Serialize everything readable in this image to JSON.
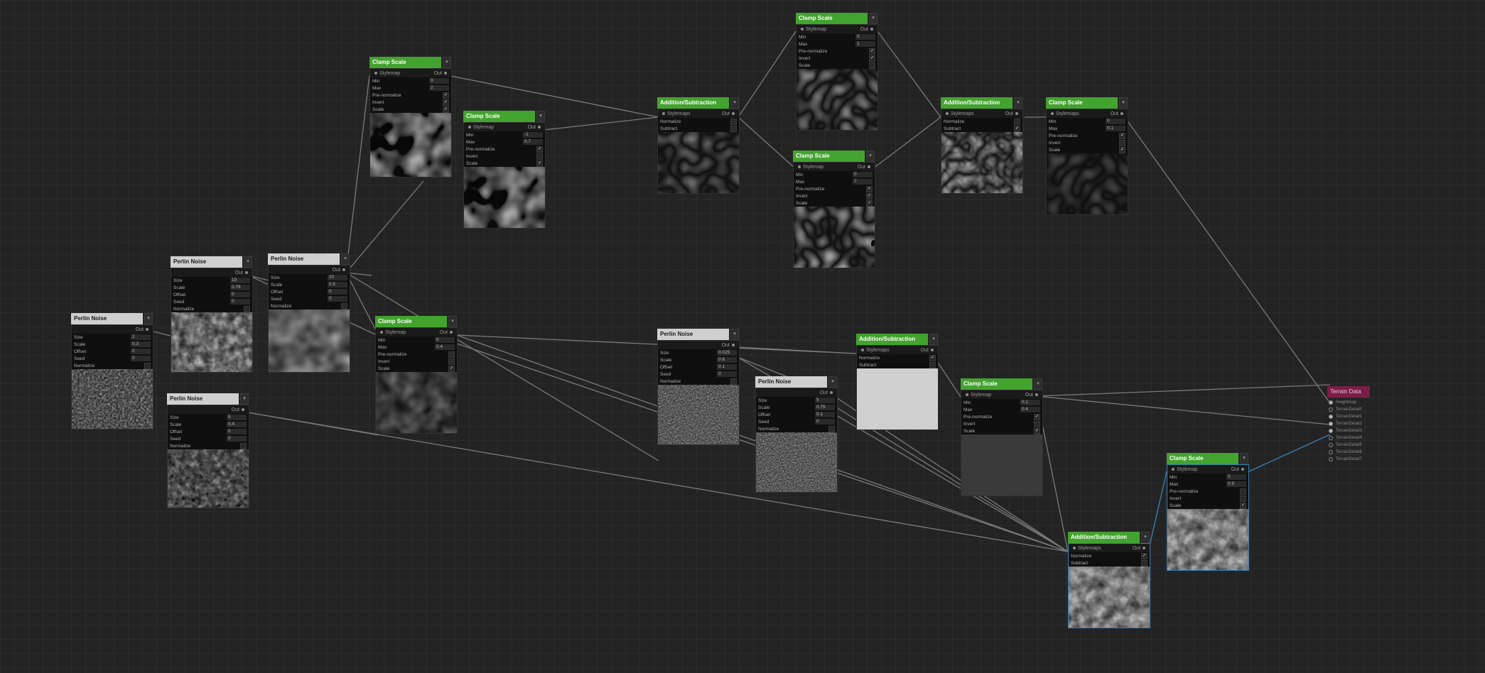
{
  "labels": {
    "out": "Out",
    "stylemap": "Stylemap",
    "stylemaps": "Stylemaps"
  },
  "colors": {
    "clamp_header": "#43a32f",
    "perlin_header": "#cfcfcf",
    "terrain_header": "#7a1e48",
    "wire": "#8a8a8a",
    "wire_selected": "#3a7cb4",
    "canvas": "#232323"
  },
  "icons": {
    "menu": "dropdown-arrow-icon",
    "port": "port-dot-icon",
    "check": "checkmark-icon"
  },
  "nodes": {
    "perlin_a": {
      "title": "Perlin Noise",
      "props": [
        {
          "label": "Size",
          "value": "2"
        },
        {
          "label": "Scale",
          "value": "0.3"
        },
        {
          "label": "Offset",
          "value": "0"
        },
        {
          "label": "Seed",
          "value": "0"
        },
        {
          "label": "Normalize",
          "checked": false
        }
      ]
    },
    "perlin_b": {
      "title": "Perlin Noise",
      "props": [
        {
          "label": "Size",
          "value": "10"
        },
        {
          "label": "Scale",
          "value": "0.79"
        },
        {
          "label": "Offset",
          "value": "0"
        },
        {
          "label": "Seed",
          "value": "0"
        },
        {
          "label": "Normalize",
          "checked": false
        }
      ]
    },
    "perlin_c": {
      "title": "Perlin Noise",
      "props": [
        {
          "label": "Size",
          "value": "5"
        },
        {
          "label": "Scale",
          "value": "0.4"
        },
        {
          "label": "Offset",
          "value": "0"
        },
        {
          "label": "Seed",
          "value": "0"
        },
        {
          "label": "Normalize",
          "checked": false
        }
      ]
    },
    "perlin_d": {
      "title": "Perlin Noise",
      "props": [
        {
          "label": "Size",
          "value": "20"
        },
        {
          "label": "Scale",
          "value": "0.5"
        },
        {
          "label": "Offset",
          "value": "0"
        },
        {
          "label": "Seed",
          "value": "0"
        },
        {
          "label": "Normalize",
          "checked": false
        }
      ]
    },
    "perlin_e": {
      "title": "Perlin Noise",
      "props": [
        {
          "label": "Size",
          "value": "0.025"
        },
        {
          "label": "Scale",
          "value": "0.6"
        },
        {
          "label": "Offset",
          "value": "0.1"
        },
        {
          "label": "Seed",
          "value": "0"
        },
        {
          "label": "Normalize",
          "checked": false
        }
      ]
    },
    "perlin_f": {
      "title": "Perlin Noise",
      "props": [
        {
          "label": "Size",
          "value": "5"
        },
        {
          "label": "Scale",
          "value": "0.75"
        },
        {
          "label": "Offset",
          "value": "0.1"
        },
        {
          "label": "Seed",
          "value": "0"
        },
        {
          "label": "Normalize",
          "checked": false
        }
      ]
    },
    "clamp_a": {
      "title": "Clamp Scale",
      "props": [
        {
          "label": "Min",
          "value": "0"
        },
        {
          "label": "Max",
          "value": "2"
        },
        {
          "label": "Pre-normalize",
          "checked": true
        },
        {
          "label": "Invert",
          "checked": true
        },
        {
          "label": "Scale",
          "checked": true
        }
      ]
    },
    "clamp_b": {
      "title": "Clamp Scale",
      "props": [
        {
          "label": "Min",
          "value": "-1"
        },
        {
          "label": "Max",
          "value": "0.7"
        },
        {
          "label": "Pre-normalize",
          "checked": true
        },
        {
          "label": "Invert",
          "checked": false
        },
        {
          "label": "Scale",
          "checked": true
        }
      ]
    },
    "clamp_c": {
      "title": "Clamp Scale",
      "props": [
        {
          "label": "Min",
          "value": "0"
        },
        {
          "label": "Max",
          "value": "0.4"
        },
        {
          "label": "Pre-normalize",
          "checked": false
        },
        {
          "label": "Invert",
          "checked": false
        },
        {
          "label": "Scale",
          "checked": true
        }
      ]
    },
    "clamp_d": {
      "title": "Clamp Scale",
      "props": [
        {
          "label": "Min",
          "value": "0"
        },
        {
          "label": "Max",
          "value": "1"
        },
        {
          "label": "Pre-normalize",
          "checked": true
        },
        {
          "label": "Invert",
          "checked": true
        },
        {
          "label": "Scale",
          "checked": false
        }
      ]
    },
    "clamp_e": {
      "title": "Clamp Scale",
      "props": [
        {
          "label": "Min",
          "value": "0"
        },
        {
          "label": "Max",
          "value": "7"
        },
        {
          "label": "Pre-normalize",
          "checked": true
        },
        {
          "label": "Invert",
          "checked": true
        },
        {
          "label": "Scale",
          "checked": true
        }
      ]
    },
    "clamp_f": {
      "title": "Clamp Scale",
      "props": [
        {
          "label": "Min",
          "value": "0"
        },
        {
          "label": "Max",
          "value": "0.1"
        },
        {
          "label": "Pre-normalize",
          "checked": true
        },
        {
          "label": "Invert",
          "checked": false
        },
        {
          "label": "Scale",
          "checked": true
        }
      ]
    },
    "clamp_g": {
      "title": "Clamp Scale",
      "props": [
        {
          "label": "Min",
          "value": "0.1"
        },
        {
          "label": "Max",
          "value": "0.4"
        },
        {
          "label": "Pre-normalize",
          "checked": true
        },
        {
          "label": "Invert",
          "checked": false
        },
        {
          "label": "Scale",
          "checked": true
        }
      ]
    },
    "clamp_h": {
      "title": "Clamp Scale",
      "props": [
        {
          "label": "Min",
          "value": "0"
        },
        {
          "label": "Max",
          "value": "0.9"
        },
        {
          "label": "Pre-normalize",
          "checked": false
        },
        {
          "label": "Invert",
          "checked": false
        },
        {
          "label": "Scale",
          "checked": true
        }
      ]
    },
    "add_a": {
      "title": "Addition/Subtraction",
      "props": [
        {
          "label": "Normalize",
          "checked": false
        },
        {
          "label": "Subtract",
          "checked": false
        }
      ]
    },
    "add_b": {
      "title": "Addition/Subtraction",
      "props": [
        {
          "label": "Normalize",
          "checked": false
        },
        {
          "label": "Subtract",
          "checked": true
        }
      ]
    },
    "add_c": {
      "title": "Addition/Subtraction",
      "props": [
        {
          "label": "Normalize",
          "checked": true
        },
        {
          "label": "Subtract",
          "checked": false
        }
      ]
    },
    "add_d": {
      "title": "Addition/Subtraction",
      "props": [
        {
          "label": "Normalize",
          "checked": true
        },
        {
          "label": "Subtract",
          "checked": false
        }
      ]
    },
    "terrain": {
      "title": "Terrain Data",
      "items": [
        "Heightmap",
        "TerrainDetail0",
        "TerrainDetail1",
        "TerrainDetail2",
        "TerrainDetail3",
        "TerrainDetail4",
        "TerrainDetail5",
        "TerrainDetail6",
        "TerrainDetail7"
      ]
    }
  }
}
